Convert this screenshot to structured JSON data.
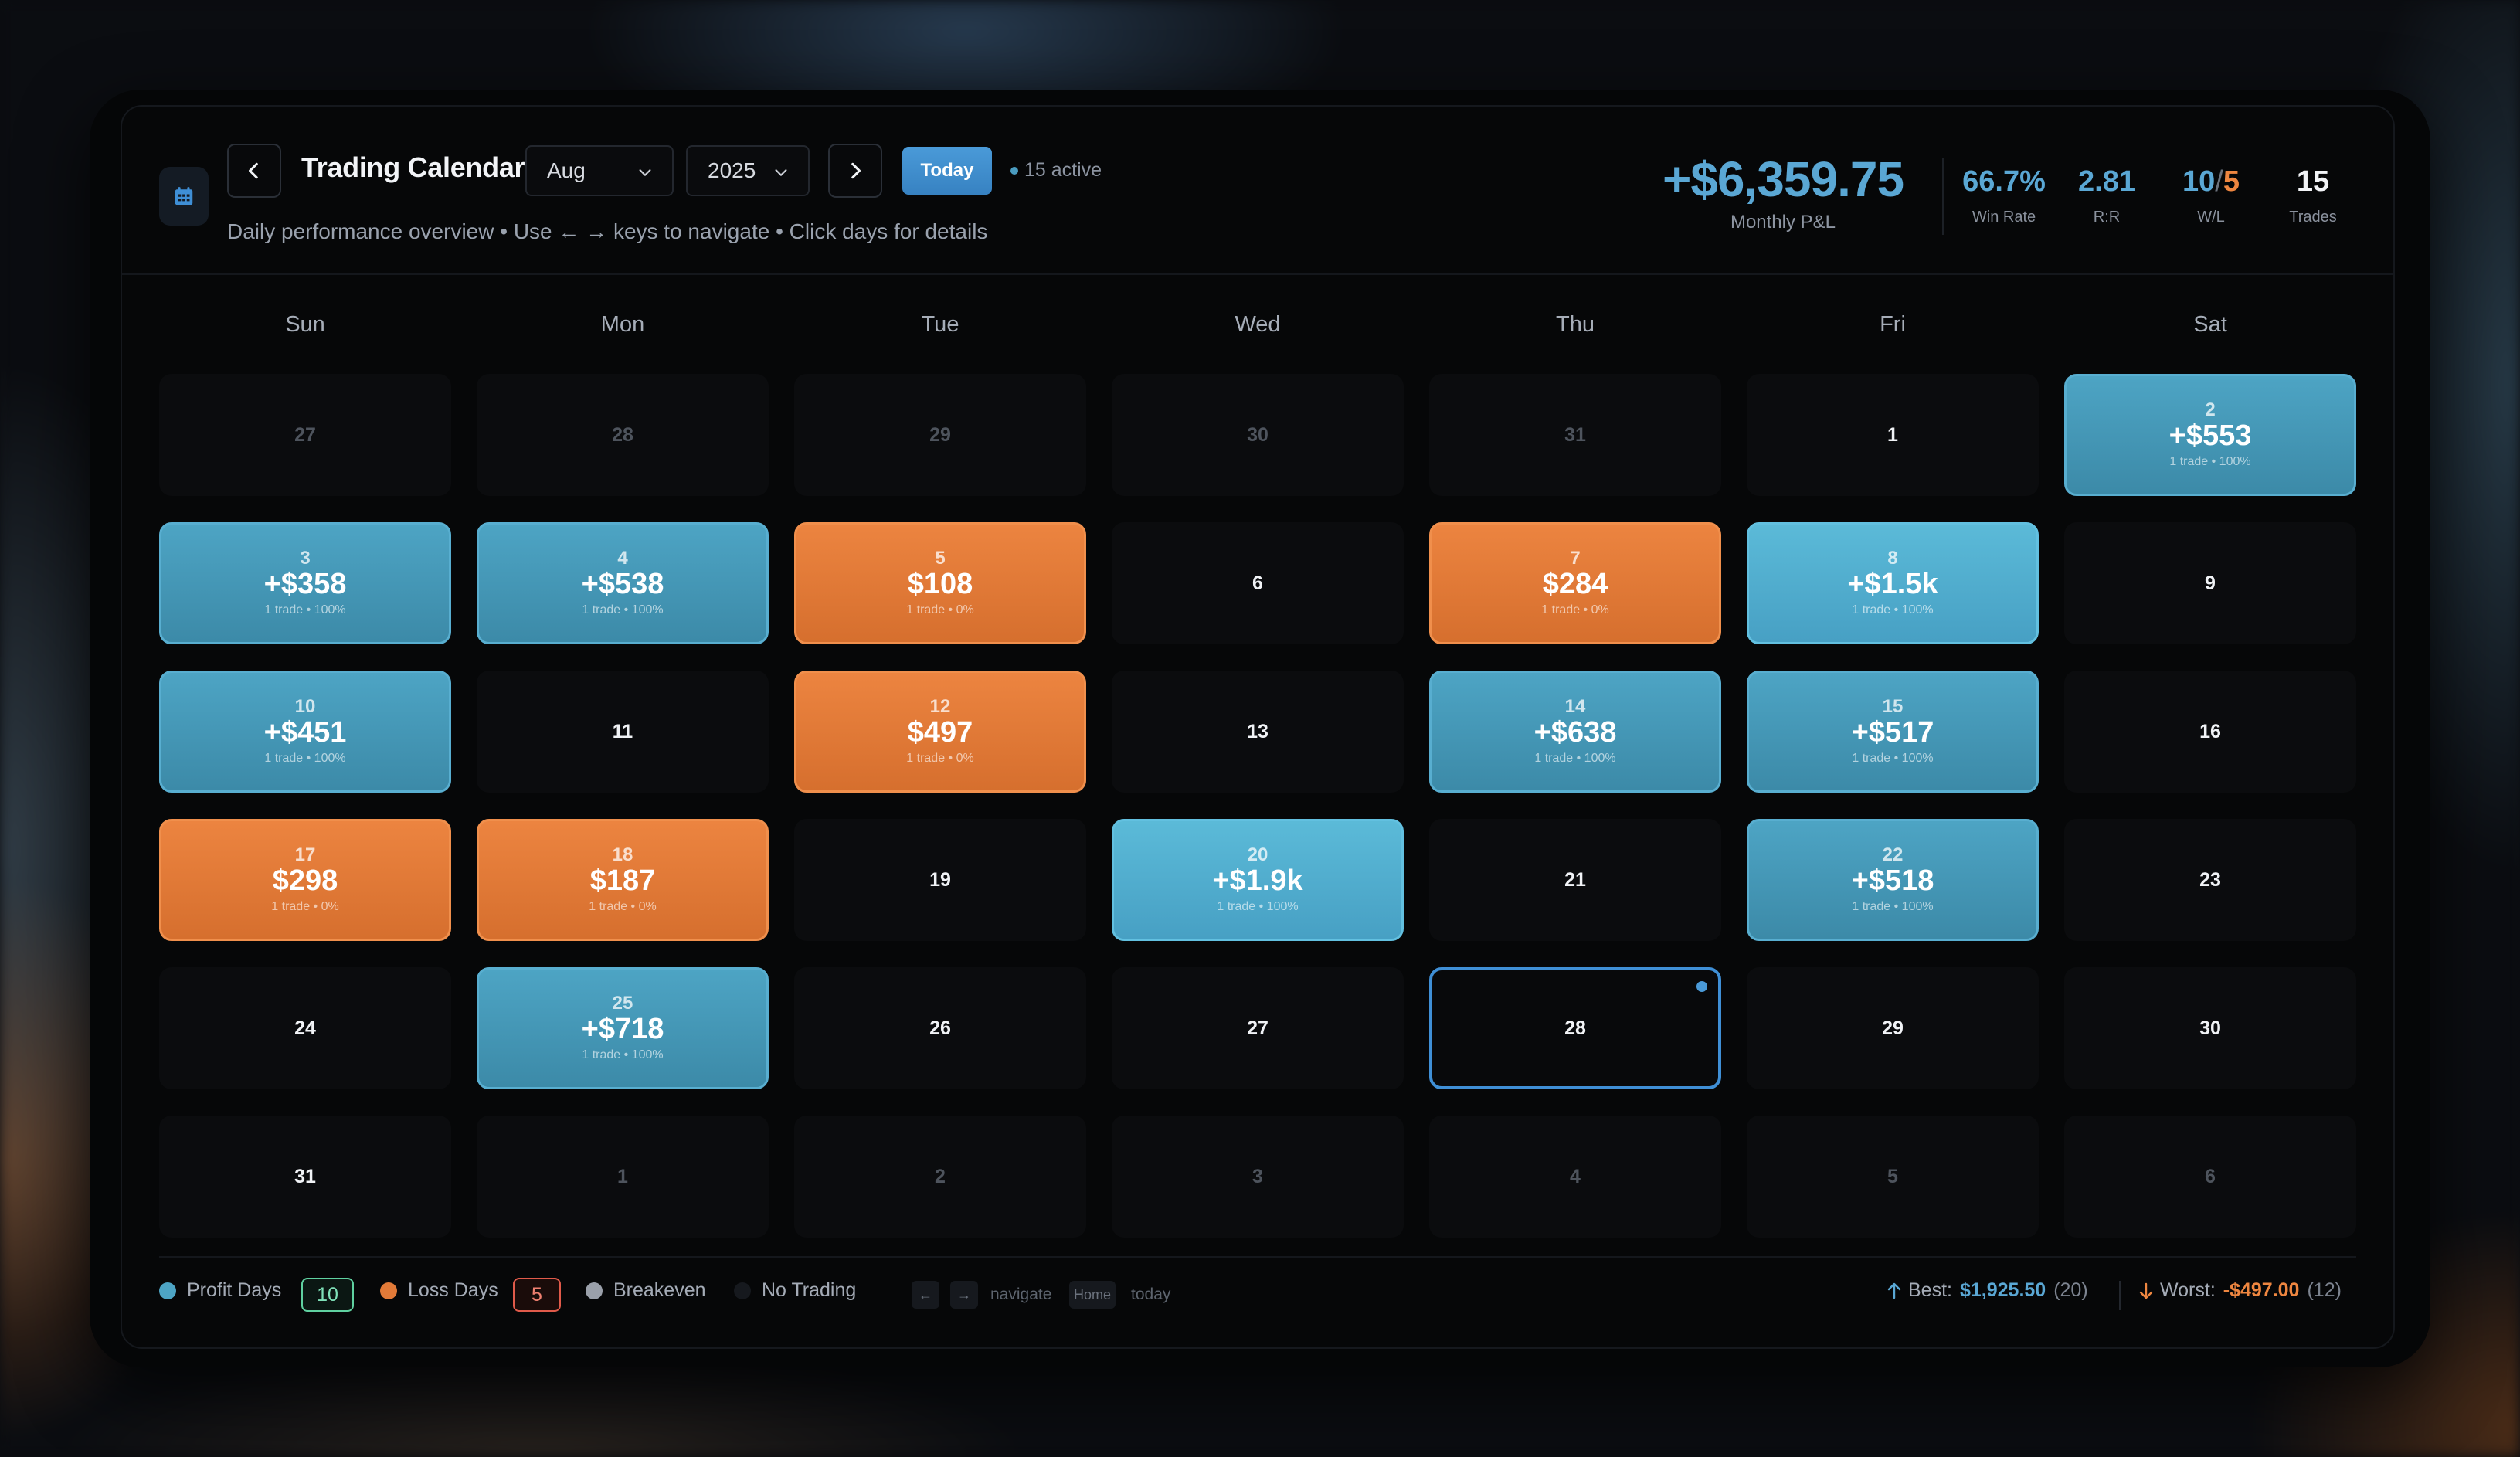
{
  "header": {
    "title": "Trading Calendar",
    "month": "Aug",
    "year": "2025",
    "today_label": "Today",
    "active_status": "15 active",
    "subtitle": "Daily performance overview • Use ← → keys to navigate • Click days for details",
    "icon_calendar": "calendar-icon",
    "icon_prev": "chevron-left-icon",
    "icon_next": "chevron-right-icon"
  },
  "summary": {
    "monthly_pnl": "+$6,359.75",
    "monthly_pnl_label": "Monthly P&L",
    "win_rate": "66.7%",
    "win_rate_label": "Win Rate",
    "rr": "2.81",
    "rr_label": "R:R",
    "wins": "10",
    "losses": "5",
    "wl_sep": "/",
    "wl_label": "W/L",
    "trades": "15",
    "trades_label": "Trades"
  },
  "weekdays": [
    "Sun",
    "Mon",
    "Tue",
    "Wed",
    "Thu",
    "Fri",
    "Sat"
  ],
  "weeks": [
    [
      {
        "day": "27",
        "type": "other"
      },
      {
        "day": "28",
        "type": "other"
      },
      {
        "day": "29",
        "type": "other"
      },
      {
        "day": "30",
        "type": "other"
      },
      {
        "day": "31",
        "type": "other"
      },
      {
        "day": "1",
        "type": "empty"
      },
      {
        "day": "2",
        "type": "profit",
        "amount": "+$553",
        "meta": "1 trade • 100%"
      }
    ],
    [
      {
        "day": "3",
        "type": "profit",
        "amount": "+$358",
        "meta": "1 trade • 100%"
      },
      {
        "day": "4",
        "type": "profit",
        "amount": "+$538",
        "meta": "1 trade • 100%"
      },
      {
        "day": "5",
        "type": "loss",
        "amount": "$108",
        "meta": "1 trade • 0%"
      },
      {
        "day": "6",
        "type": "empty"
      },
      {
        "day": "7",
        "type": "loss",
        "amount": "$284",
        "meta": "1 trade • 0%"
      },
      {
        "day": "8",
        "type": "profit",
        "amount": "+$1.5k",
        "meta": "1 trade • 100%",
        "highlight": true
      },
      {
        "day": "9",
        "type": "empty"
      }
    ],
    [
      {
        "day": "10",
        "type": "profit",
        "amount": "+$451",
        "meta": "1 trade • 100%"
      },
      {
        "day": "11",
        "type": "empty"
      },
      {
        "day": "12",
        "type": "loss",
        "amount": "$497",
        "meta": "1 trade • 0%"
      },
      {
        "day": "13",
        "type": "empty"
      },
      {
        "day": "14",
        "type": "profit",
        "amount": "+$638",
        "meta": "1 trade • 100%"
      },
      {
        "day": "15",
        "type": "profit",
        "amount": "+$517",
        "meta": "1 trade • 100%"
      },
      {
        "day": "16",
        "type": "empty"
      }
    ],
    [
      {
        "day": "17",
        "type": "loss",
        "amount": "$298",
        "meta": "1 trade • 0%"
      },
      {
        "day": "18",
        "type": "loss",
        "amount": "$187",
        "meta": "1 trade • 0%"
      },
      {
        "day": "19",
        "type": "empty"
      },
      {
        "day": "20",
        "type": "profit",
        "amount": "+$1.9k",
        "meta": "1 trade • 100%",
        "highlight": true
      },
      {
        "day": "21",
        "type": "empty"
      },
      {
        "day": "22",
        "type": "profit",
        "amount": "+$518",
        "meta": "1 trade • 100%"
      },
      {
        "day": "23",
        "type": "empty"
      }
    ],
    [
      {
        "day": "24",
        "type": "empty"
      },
      {
        "day": "25",
        "type": "profit",
        "amount": "+$718",
        "meta": "1 trade • 100%"
      },
      {
        "day": "26",
        "type": "empty"
      },
      {
        "day": "27",
        "type": "empty"
      },
      {
        "day": "28",
        "type": "today"
      },
      {
        "day": "29",
        "type": "empty"
      },
      {
        "day": "30",
        "type": "empty"
      }
    ],
    [
      {
        "day": "31",
        "type": "empty"
      },
      {
        "day": "1",
        "type": "other"
      },
      {
        "day": "2",
        "type": "other"
      },
      {
        "day": "3",
        "type": "other"
      },
      {
        "day": "4",
        "type": "other"
      },
      {
        "day": "5",
        "type": "other"
      },
      {
        "day": "6",
        "type": "other"
      }
    ]
  ],
  "legend": {
    "profit_label": "Profit Days",
    "profit_count": "10",
    "loss_label": "Loss Days",
    "loss_count": "5",
    "breakeven_label": "Breakeven",
    "no_trading_label": "No Trading",
    "key_left": "←",
    "key_right": "→",
    "navigate_hint": "navigate",
    "key_home": "Home",
    "today_hint": "today"
  },
  "extremes": {
    "best_label": "Best:",
    "best_value": "$1,925.50",
    "best_day": "(20)",
    "worst_label": "Worst:",
    "worst_value": "-$497.00",
    "worst_day": "(12)"
  },
  "colors": {
    "profit": "#4da4c4",
    "loss": "#e27a38",
    "breakeven": "#9aa0aa",
    "accent": "#3f8fd6"
  }
}
